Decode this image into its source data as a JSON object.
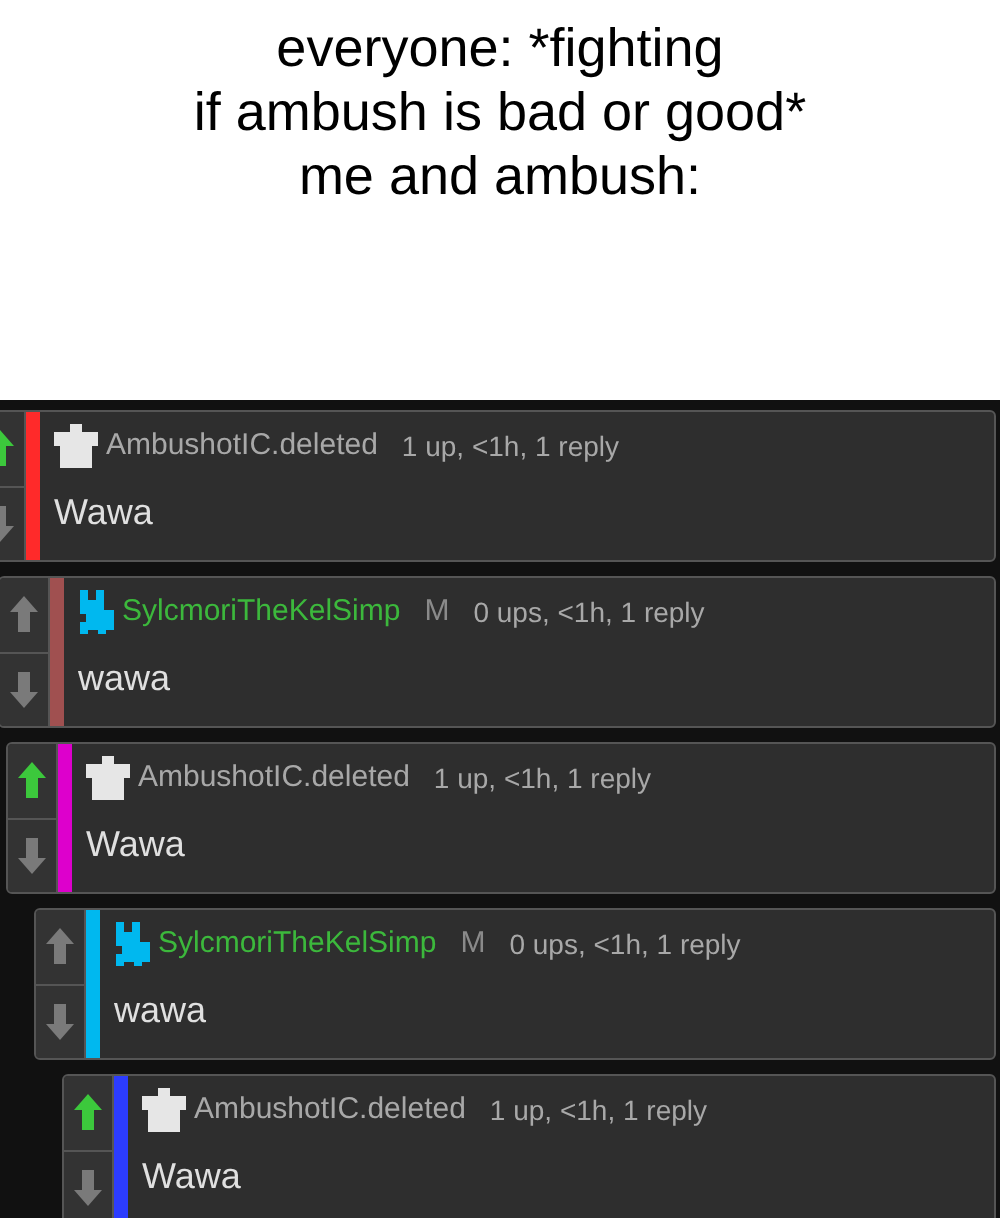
{
  "caption": [
    "everyone: *fighting",
    "if ambush is bad or good*",
    "me and ambush:"
  ],
  "comments": [
    {
      "kind": "deleted",
      "author": "AmbushotIC.deleted",
      "meta": "1 up, <1h, 1 reply",
      "body": "Wawa",
      "color": "#ff2a2a",
      "upvoted": true,
      "children": [
        {
          "kind": "user",
          "author": "SylcmoriTheKelSimp",
          "badge": "M",
          "meta": "0 ups, <1h, 1 reply",
          "body": "wawa",
          "color": "#a05050",
          "upvoted": false,
          "children": [
            {
              "kind": "deleted",
              "author": "AmbushotIC.deleted",
              "meta": "1 up, <1h, 1 reply",
              "body": "Wawa",
              "color": "#dd00cc",
              "upvoted": true,
              "children": [
                {
                  "kind": "user",
                  "author": "SylcmoriTheKelSimp",
                  "badge": "M",
                  "meta": "0 ups, <1h, 1 reply",
                  "body": "wawa",
                  "color": "#00b8ef",
                  "upvoted": false,
                  "children": [
                    {
                      "kind": "deleted",
                      "author": "AmbushotIC.deleted",
                      "meta": "1 up, <1h, 1 reply",
                      "body": "Wawa",
                      "color": "#2c3cff",
                      "upvoted": true
                    }
                  ]
                }
              ]
            }
          ]
        }
      ]
    }
  ]
}
